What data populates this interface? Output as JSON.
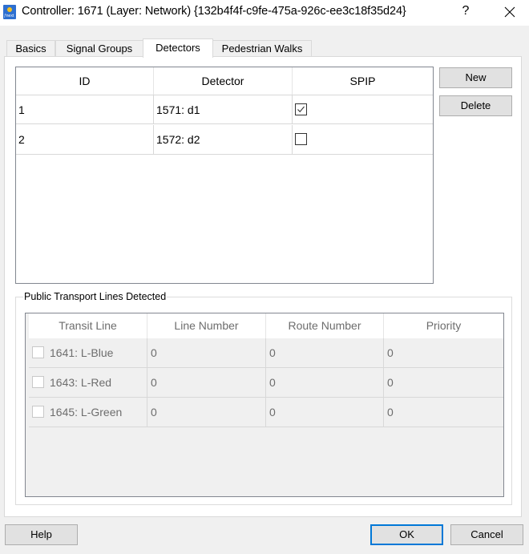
{
  "window": {
    "title": "Controller: 1671 (Layer: Network) {132b4f4f-c9fe-475a-926c-ee3c18f35d24}",
    "app_icon": "vissim-app-icon",
    "app_icon_text": "ƒnext",
    "help_glyph": "?",
    "close_icon": "close-icon"
  },
  "tabs": [
    {
      "label": "Basics",
      "active": false
    },
    {
      "label": "Signal Groups",
      "active": false
    },
    {
      "label": "Detectors",
      "active": true
    },
    {
      "label": "Pedestrian Walks",
      "active": false
    }
  ],
  "detectors": {
    "columns": [
      "ID",
      "Detector",
      "SPIP"
    ],
    "rows": [
      {
        "id": "1",
        "detector": "1571: d1",
        "spip": true
      },
      {
        "id": "2",
        "detector": "1572: d2",
        "spip": false
      }
    ],
    "new_label": "New",
    "delete_label": "Delete"
  },
  "public_transport": {
    "group_title": "Public Transport Lines Detected",
    "columns": [
      "Transit Line",
      "Line Number",
      "Route Number",
      "Priority"
    ],
    "rows": [
      {
        "checked": false,
        "transit_line": "1641: L-Blue",
        "line_number": "0",
        "route_number": "0",
        "priority": "0"
      },
      {
        "checked": false,
        "transit_line": "1643: L-Red",
        "line_number": "0",
        "route_number": "0",
        "priority": "0"
      },
      {
        "checked": false,
        "transit_line": "1645: L-Green",
        "line_number": "0",
        "route_number": "0",
        "priority": "0"
      }
    ]
  },
  "footer": {
    "help_label": "Help",
    "ok_label": "OK",
    "cancel_label": "Cancel"
  },
  "colors": {
    "focus_border": "#0078d7",
    "disabled_text": "#6d6d6d"
  }
}
